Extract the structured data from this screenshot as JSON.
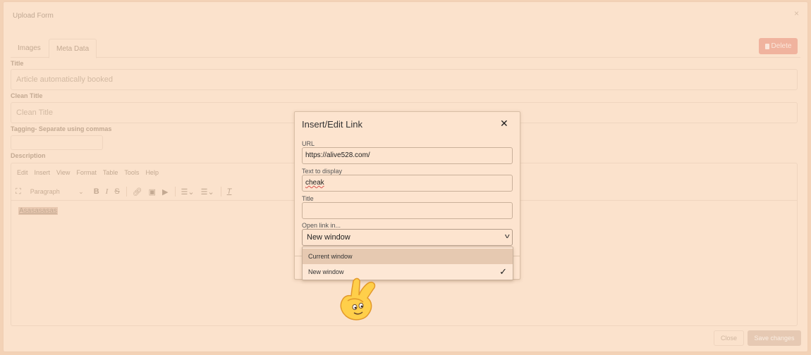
{
  "upload_form": {
    "title": "Upload Form",
    "close_glyph": "×",
    "tabs": [
      {
        "label": "Images",
        "active": false
      },
      {
        "label": "Meta Data",
        "active": true
      }
    ],
    "delete_label": "Delete",
    "fields": {
      "title_label": "Title",
      "title_value": "Article automatically booked",
      "clean_title_label": "Clean Title",
      "clean_title_placeholder": "Clean Title",
      "tagging_label": "Tagging- Separate using commas",
      "description_label": "Description"
    },
    "editor": {
      "menu": [
        "Edit",
        "Insert",
        "View",
        "Format",
        "Table",
        "Tools",
        "Help"
      ],
      "block_format": "Paragraph",
      "content": "Asasasasas"
    },
    "footer": {
      "close_label": "Close",
      "save_label": "Save changes"
    }
  },
  "dialog": {
    "title": "Insert/Edit Link",
    "close_glyph": "✕",
    "url_label": "URL",
    "url_value": "https://alive528.com/",
    "text_label": "Text to display",
    "text_value": "cheak",
    "title_label": "Title",
    "title_value": "",
    "open_in_label": "Open link in...",
    "open_in_value": "New window",
    "options": [
      {
        "label": "Current window",
        "selected": false,
        "highlighted": true
      },
      {
        "label": "New window",
        "selected": true,
        "highlighted": false
      }
    ],
    "check_glyph": "✓"
  },
  "colors": {
    "overlay": "#f3d2b6",
    "dialog_bg": "#fde4cf",
    "highlight": "#e6c9b1",
    "delete_button": "#f0b39e"
  },
  "icons": [
    "fullscreen-icon",
    "bold-icon",
    "italic-icon",
    "strikethrough-icon",
    "link-icon",
    "image-icon",
    "media-icon",
    "numbered-list-icon",
    "bullet-list-icon",
    "clear-formatting-icon",
    "chevron-down-icon",
    "check-icon",
    "hand-emoji-icon"
  ]
}
